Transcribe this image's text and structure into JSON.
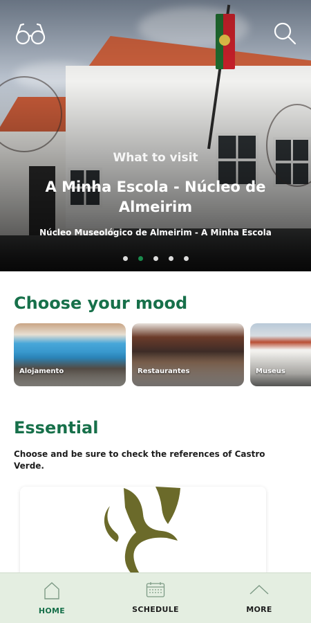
{
  "hero": {
    "category": "What to visit",
    "title": "A Minha Escola - Núcleo de Almeirim",
    "subtitle": "Núcleo Museológico de Almeirim - A Minha Escola",
    "slides": 5,
    "active_slide": 2
  },
  "mood": {
    "title": "Choose your mood",
    "cards": [
      {
        "label": "Alojamento"
      },
      {
        "label": "Restaurantes"
      },
      {
        "label": "Museus"
      }
    ]
  },
  "essential": {
    "title": "Essential",
    "description": "Choose and be sure to check the references of Castro Verde."
  },
  "nav": {
    "home": "HOME",
    "schedule": "SCHEDULE",
    "more": "MORE"
  },
  "colors": {
    "brand_green": "#17704a",
    "nav_background": "#e4eee1",
    "logo_olive": "#6b6a2a"
  },
  "icons": {
    "top_left": "glasses-icon",
    "top_right": "search-icon",
    "home": "home-icon",
    "schedule": "calendar-icon",
    "more": "chevron-up-icon"
  }
}
